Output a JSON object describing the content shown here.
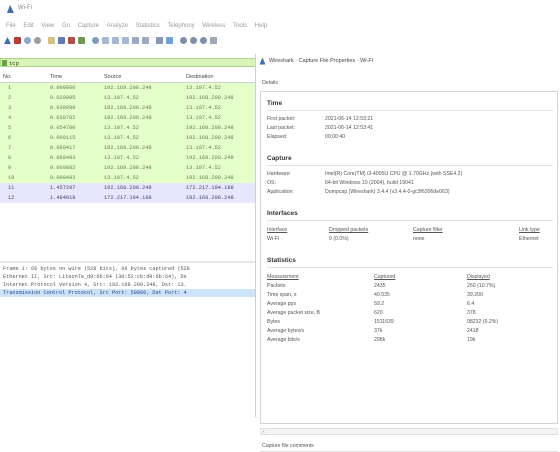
{
  "window": {
    "title": "Wi-Fi"
  },
  "menu": [
    "File",
    "Edit",
    "View",
    "Go",
    "Capture",
    "Analyze",
    "Statistics",
    "Telephony",
    "Wireless",
    "Tools",
    "Help"
  ],
  "filter": {
    "value": "tcp"
  },
  "packet_list": {
    "headers": [
      "No.",
      "Time",
      "Source",
      "Destination"
    ],
    "rows": [
      {
        "no": "1",
        "time": "0.000000",
        "src": "192.168.200.248",
        "dst": "13.107.4.52",
        "style": "green"
      },
      {
        "no": "2",
        "time": "0.029895",
        "src": "13.107.4.52",
        "dst": "192.168.200.248",
        "style": "green"
      },
      {
        "no": "3",
        "time": "0.030090",
        "src": "192.168.200.248",
        "dst": "13.107.4.52",
        "style": "green"
      },
      {
        "no": "4",
        "time": "0.030782",
        "src": "192.168.200.248",
        "dst": "13.107.4.52",
        "style": "green"
      },
      {
        "no": "5",
        "time": "0.054780",
        "src": "13.107.4.52",
        "dst": "192.168.200.248",
        "style": "green"
      },
      {
        "no": "6",
        "time": "0.060115",
        "src": "13.107.4.52",
        "dst": "192.168.200.248",
        "style": "green"
      },
      {
        "no": "7",
        "time": "0.060417",
        "src": "192.168.200.248",
        "dst": "13.107.4.52",
        "style": "green"
      },
      {
        "no": "8",
        "time": "0.060493",
        "src": "13.107.4.52",
        "dst": "192.168.200.248",
        "style": "green"
      },
      {
        "no": "9",
        "time": "0.060882",
        "src": "192.168.200.248",
        "dst": "13.107.4.52",
        "style": "green"
      },
      {
        "no": "10",
        "time": "0.090493",
        "src": "13.107.4.52",
        "dst": "192.168.200.248",
        "style": "green"
      },
      {
        "no": "11",
        "time": "1.457297",
        "src": "192.168.200.248",
        "dst": "172.217.194.188",
        "style": "tcp2"
      },
      {
        "no": "12",
        "time": "1.484918",
        "src": "172.217.194.188",
        "dst": "192.168.200.248",
        "style": "tcp2"
      }
    ]
  },
  "packet_details": [
    "Frame 1: 66 bytes on wire (528 bits), 66 bytes captured (528",
    "Ethernet II, Src: LiteonTe_d9:6b:64 (30:52:cb:d9:6b:64), Ds",
    "Internet Protocol Version 4, Src: 192.168.200.248, Dst: 13.",
    "Transmission Control Protocol, Src Port: 50860, Dst Port: 4"
  ],
  "dialog": {
    "title": "Wireshark · Capture File Properties · Wi-Fi",
    "details_label": "Details",
    "time": {
      "heading": "Time",
      "rows": [
        {
          "label": "First packet:",
          "value": "2021-06-14 12:53:21"
        },
        {
          "label": "Last packet:",
          "value": "2021-06-14 12:53:41"
        },
        {
          "label": "Elapsed:",
          "value": "00:00:40"
        }
      ]
    },
    "capture": {
      "heading": "Capture",
      "rows": [
        {
          "label": "Hardware:",
          "value": "Intel(R) Core(TM) i3-4005U CPU @ 1.70GHz (with SSE4.2)"
        },
        {
          "label": "OS:",
          "value": "64-bit Windows 10 (2004), build 19041"
        },
        {
          "label": "Application:",
          "value": "Dumpcap (Wireshark) 3.4.4 (v3.4.4-0-gc3f6306de063)"
        }
      ]
    },
    "interfaces": {
      "heading": "Interfaces",
      "headers": [
        "Interface",
        "Dropped packets",
        "Capture filter",
        "Link type"
      ],
      "row": [
        "Wi-Fi",
        "0 (0.0%)",
        "none",
        "Ethernet"
      ]
    },
    "statistics": {
      "heading": "Statistics",
      "headers": [
        "Measurement",
        "Captured",
        "Displayed"
      ],
      "rows": [
        [
          "Packets",
          "2435",
          "260 (10.7%)"
        ],
        [
          "Time span, s",
          "40.535",
          "39.200"
        ],
        [
          "Average pps",
          "59.2",
          "6.4"
        ],
        [
          "Average packet size, B",
          "620",
          "378"
        ],
        [
          "Bytes",
          "1511639",
          "98232 (6.2%)"
        ],
        [
          "Average bytes/s",
          "37k",
          "2418"
        ],
        [
          "Average bits/s",
          "298k",
          "19k"
        ]
      ]
    },
    "comments_label": "Capture file comments"
  },
  "colors": {
    "green_row": "#e4ffc7",
    "tcp_row": "#e7e6ff",
    "filter_bg": "#d8f5b9",
    "selected": "#cde3fb"
  },
  "icons": [
    "shark-fin-icon",
    "stop-icon",
    "restart-icon",
    "options-icon",
    "open-icon",
    "save-icon",
    "close-icon",
    "reload-icon",
    "find-icon",
    "back-icon",
    "forward-icon",
    "go-to-icon",
    "first-icon",
    "last-icon",
    "autoscroll-icon",
    "colorize-icon",
    "zoom-in-icon",
    "zoom-out-icon",
    "zoom-reset-icon",
    "resize-columns-icon"
  ]
}
